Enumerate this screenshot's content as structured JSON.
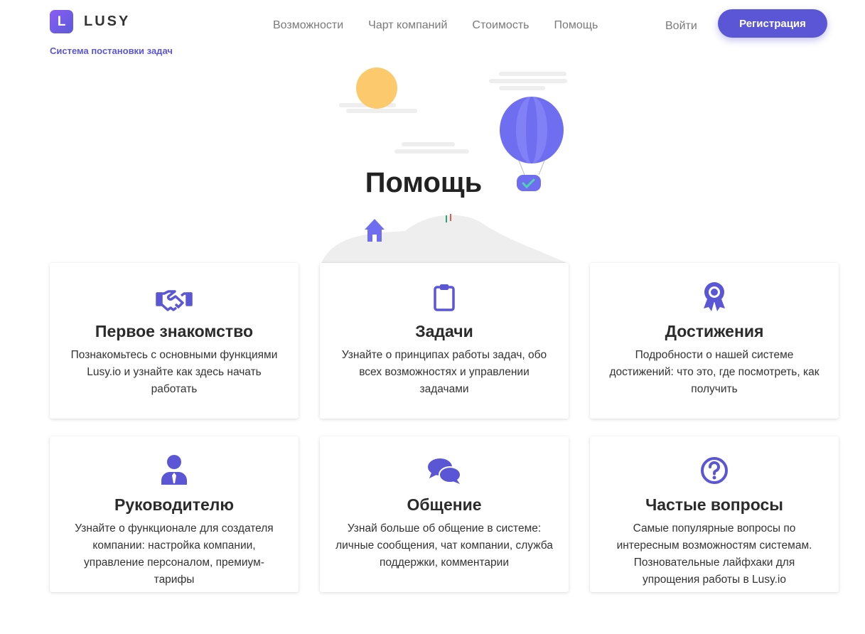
{
  "header": {
    "logo_letter": "L",
    "logo_text": "LUSY",
    "tagline": "Система постановки задач",
    "nav": [
      "Возможности",
      "Чарт компаний",
      "Стоимость",
      "Помощь"
    ],
    "login": "Войти",
    "register": "Регистрация"
  },
  "hero": {
    "title": "Помощь"
  },
  "colors": {
    "accent": "#5b56d6",
    "sun": "#fcc96c",
    "balloon": "#6f6ef0",
    "check": "#4dd4b0"
  },
  "cards": [
    {
      "icon": "handshake-icon",
      "title": "Первое знакомство",
      "text": "Познакомьтесь с основными функциями Lusy.io и узнайте как здесь начать работать"
    },
    {
      "icon": "clipboard-icon",
      "title": "Задачи",
      "text": "Узнайте о принципах работы задач, обо всех возможностях и управлении задачами"
    },
    {
      "icon": "award-icon",
      "title": "Достижения",
      "text": "Подробности о нашей системе достижений: что это, где посмотреть, как получить"
    },
    {
      "icon": "user-tie-icon",
      "title": "Руководителю",
      "text": "Узнайте о функционале для создателя компании: настройка компании, управление персоналом, премиум-тарифы"
    },
    {
      "icon": "chat-icon",
      "title": "Общение",
      "text": "Узнай больше об общение в системе: личные сообщения, чат компании, служба поддержки, комментарии"
    },
    {
      "icon": "question-circle-icon",
      "title": "Частые вопросы",
      "text": "Самые популярные вопросы по интересным возможностям системам. Позновательные лайфхаки для упрощения работы в Lusy.io"
    }
  ]
}
